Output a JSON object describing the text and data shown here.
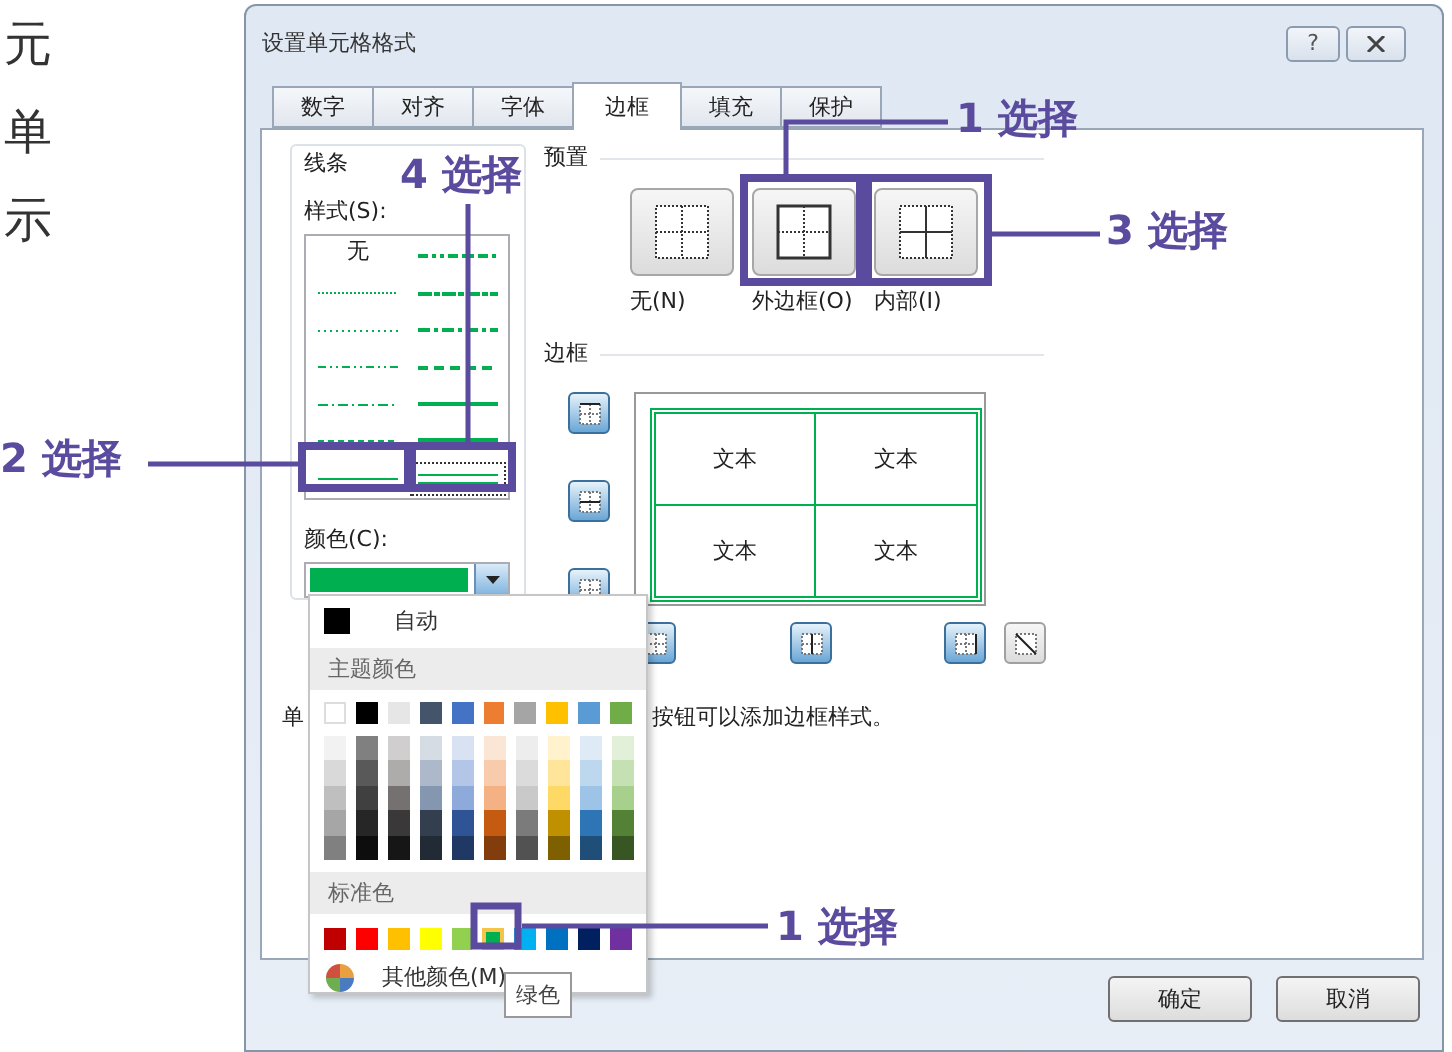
{
  "page_text": [
    "元",
    "单",
    "示"
  ],
  "window": {
    "title": "设置单元格格式",
    "help": "?"
  },
  "tabs": [
    {
      "label": "数字",
      "selected": false
    },
    {
      "label": "对齐",
      "selected": false
    },
    {
      "label": "字体",
      "selected": false
    },
    {
      "label": "边框",
      "selected": true
    },
    {
      "label": "填充",
      "selected": false
    },
    {
      "label": "保护",
      "selected": false
    }
  ],
  "lines": {
    "title": "线条",
    "style_label": "样式(S):",
    "color_label": "颜色(C):",
    "color": "#00b050",
    "styles": [
      {
        "kind": "none",
        "label": "无",
        "selected": false
      },
      {
        "kind": "hair",
        "selected": false
      },
      {
        "kind": "dotted",
        "selected": false
      },
      {
        "kind": "dash-dot-dot",
        "selected": false
      },
      {
        "kind": "dash-dot",
        "selected": false
      },
      {
        "kind": "dashed",
        "selected": false
      },
      {
        "kind": "thin",
        "selected": false
      },
      {
        "kind": "medium-dash-dot-dot",
        "selected": false
      },
      {
        "kind": "slant-dash-dot",
        "selected": false
      },
      {
        "kind": "medium-dash-dot",
        "selected": false
      },
      {
        "kind": "medium-dashed",
        "selected": false
      },
      {
        "kind": "medium",
        "selected": false
      },
      {
        "kind": "thick",
        "selected": false
      },
      {
        "kind": "double",
        "selected": true
      }
    ]
  },
  "presets": {
    "title": "预置",
    "items": [
      {
        "kind": "none",
        "label": "无(N)"
      },
      {
        "kind": "outline",
        "label": "外边框(O)"
      },
      {
        "kind": "inside",
        "label": "内部(I)"
      }
    ]
  },
  "border": {
    "title": "边框",
    "side_toggles": [
      {
        "kind": "top",
        "on": true
      },
      {
        "kind": "middle-horizontal",
        "on": true
      },
      {
        "kind": "bottom",
        "on": true
      }
    ],
    "bottom_toggles": [
      {
        "kind": "left",
        "on": true
      },
      {
        "kind": "middle-vertical",
        "on": true
      },
      {
        "kind": "right",
        "on": true
      },
      {
        "kind": "diagonal",
        "on": false
      }
    ],
    "preview_cells": [
      "文本",
      "文本",
      "文本",
      "文本"
    ]
  },
  "hint": [
    "单",
    "按钮可以添加边框样式。"
  ],
  "color_menu": {
    "auto": "自动",
    "theme_title": "主题颜色",
    "theme": [
      {
        "color": "#ffffff",
        "shades": [
          {
            "color": "#f2f2f2"
          },
          {
            "color": "#d9d9d9"
          },
          {
            "color": "#bfbfbf"
          },
          {
            "color": "#a6a6a6"
          },
          {
            "color": "#808080"
          }
        ]
      },
      {
        "color": "#000000",
        "shades": [
          {
            "color": "#808080"
          },
          {
            "color": "#595959"
          },
          {
            "color": "#404040"
          },
          {
            "color": "#262626"
          },
          {
            "color": "#0d0d0d"
          }
        ]
      },
      {
        "color": "#e7e6e6",
        "shades": [
          {
            "color": "#d0cece"
          },
          {
            "color": "#aeabab"
          },
          {
            "color": "#757171"
          },
          {
            "color": "#3a3838"
          },
          {
            "color": "#171616"
          }
        ]
      },
      {
        "color": "#44546a",
        "shades": [
          {
            "color": "#d6dce4"
          },
          {
            "color": "#adb9ca"
          },
          {
            "color": "#8496b0"
          },
          {
            "color": "#333f4f"
          },
          {
            "color": "#222a35"
          }
        ]
      },
      {
        "color": "#4472c4",
        "shades": [
          {
            "color": "#d9e2f3"
          },
          {
            "color": "#b4c6e7"
          },
          {
            "color": "#8eaadb"
          },
          {
            "color": "#2f5496"
          },
          {
            "color": "#1f3864"
          }
        ]
      },
      {
        "color": "#ed7d31",
        "shades": [
          {
            "color": "#fbe5d5"
          },
          {
            "color": "#f7cbac"
          },
          {
            "color": "#f4b183"
          },
          {
            "color": "#c55a11"
          },
          {
            "color": "#833c0b"
          }
        ]
      },
      {
        "color": "#a5a5a5",
        "shades": [
          {
            "color": "#ededed"
          },
          {
            "color": "#dbdbdb"
          },
          {
            "color": "#c9c9c9"
          },
          {
            "color": "#7b7b7b"
          },
          {
            "color": "#525252"
          }
        ]
      },
      {
        "color": "#ffc000",
        "shades": [
          {
            "color": "#fff2cc"
          },
          {
            "color": "#fee599"
          },
          {
            "color": "#ffd965"
          },
          {
            "color": "#bf9000"
          },
          {
            "color": "#7f6000"
          }
        ]
      },
      {
        "color": "#5b9bd5",
        "shades": [
          {
            "color": "#deebf6"
          },
          {
            "color": "#bdd7ee"
          },
          {
            "color": "#9dc3e6"
          },
          {
            "color": "#2e75b5"
          },
          {
            "color": "#1f4e79"
          }
        ]
      },
      {
        "color": "#70ad47",
        "shades": [
          {
            "color": "#e2efd9"
          },
          {
            "color": "#c5e0b3"
          },
          {
            "color": "#a8d08d"
          },
          {
            "color": "#538135"
          },
          {
            "color": "#375623"
          }
        ]
      }
    ],
    "standard_title": "标准色",
    "standard": [
      {
        "color": "#c00000",
        "selected": false
      },
      {
        "color": "#ff0000",
        "selected": false
      },
      {
        "color": "#ffc000",
        "selected": false
      },
      {
        "color": "#ffff00",
        "selected": false
      },
      {
        "color": "#92d050",
        "selected": false
      },
      {
        "color": "#00b050",
        "selected": true
      },
      {
        "color": "#00b0f0",
        "selected": false
      },
      {
        "color": "#0070c0",
        "selected": false
      },
      {
        "color": "#002060",
        "selected": false
      },
      {
        "color": "#7030a0",
        "selected": false
      }
    ],
    "more": "其他颜色(M)",
    "tooltip": "绿色"
  },
  "buttons": [
    "确定",
    "取消"
  ],
  "callouts": [
    {
      "text": "1 选择"
    },
    {
      "text": "4 选择"
    },
    {
      "text": "3 选择"
    },
    {
      "text": "2 选择"
    },
    {
      "text": "1 选择"
    }
  ]
}
